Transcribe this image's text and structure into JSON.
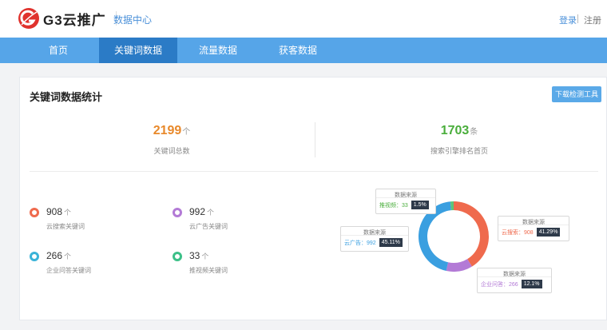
{
  "header": {
    "brand": "G3云推广",
    "subtitle": "数据中心",
    "login": "登录",
    "register": "注册"
  },
  "nav": {
    "items": [
      {
        "label": "首页"
      },
      {
        "label": "关键词数据",
        "active": true
      },
      {
        "label": "流量数据"
      },
      {
        "label": "获客数据"
      }
    ]
  },
  "main": {
    "title": "关键词数据统计",
    "download_button": "下载检测工具",
    "stats": [
      {
        "value": "2199",
        "unit": "个",
        "label": "关键词总数",
        "color": "#e8892b"
      },
      {
        "value": "1703",
        "unit": "条",
        "label": "搜索引擎排名首页",
        "color": "#4aae3c"
      }
    ],
    "keywords": [
      {
        "value": "908",
        "unit": "个",
        "label": "云搜索关键词",
        "color": "#ef6a4d"
      },
      {
        "value": "992",
        "unit": "个",
        "label": "云广告关键词",
        "color": "#b37ad6"
      },
      {
        "value": "266",
        "unit": "个",
        "label": "企业问答关键词",
        "color": "#3ab3d8"
      },
      {
        "value": "33",
        "unit": "个",
        "label": "推视频关键词",
        "color": "#3cc088"
      }
    ]
  },
  "chart_data": {
    "type": "pie",
    "title": "",
    "callout_title": "数据来源",
    "series": [
      {
        "name": "云搜索",
        "value": 908,
        "percent": "41.29%",
        "color": "#ef6a4d"
      },
      {
        "name": "企业问答",
        "value": 266,
        "percent": "12.1%",
        "color": "#b37ad6"
      },
      {
        "name": "云广告",
        "value": 992,
        "percent": "45.11%",
        "color": "#3a9fe0"
      },
      {
        "name": "推视频",
        "value": 33,
        "percent": "1.5%",
        "color": "#5cc47a"
      }
    ]
  }
}
